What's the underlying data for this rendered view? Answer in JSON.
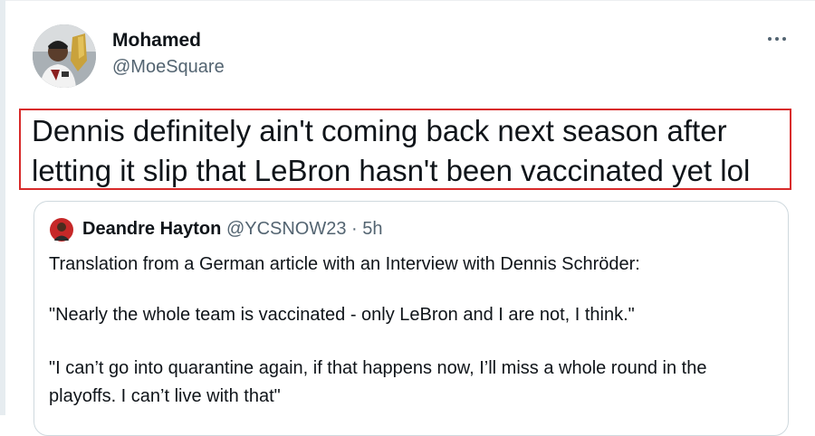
{
  "tweet": {
    "author_name": "Mohamed",
    "author_handle": "@MoeSquare",
    "more_icon": "more-horizontal-icon",
    "text": "Dennis definitely ain't coming back next season after\nletting it slip that LeBron hasn't been vaccinated yet lol",
    "highlight_color": "#d82a2a"
  },
  "quoted_tweet": {
    "author_name": "Deandre Hayton",
    "author_handle": "@YCSNOW23",
    "separator": " · ",
    "time": "5h",
    "paragraphs": [
      "Translation from a German article with an Interview with Dennis Schröder:",
      "\"Nearly the whole team is vaccinated - only LeBron and I are not, I think.\"",
      "\"I can’t go into quarantine again, if that happens now, I’ll miss a whole round in the playoffs. I can’t live with that\""
    ]
  },
  "colors": {
    "text_primary": "#0f1419",
    "text_secondary": "#536471",
    "card_border": "#cfd9de"
  }
}
